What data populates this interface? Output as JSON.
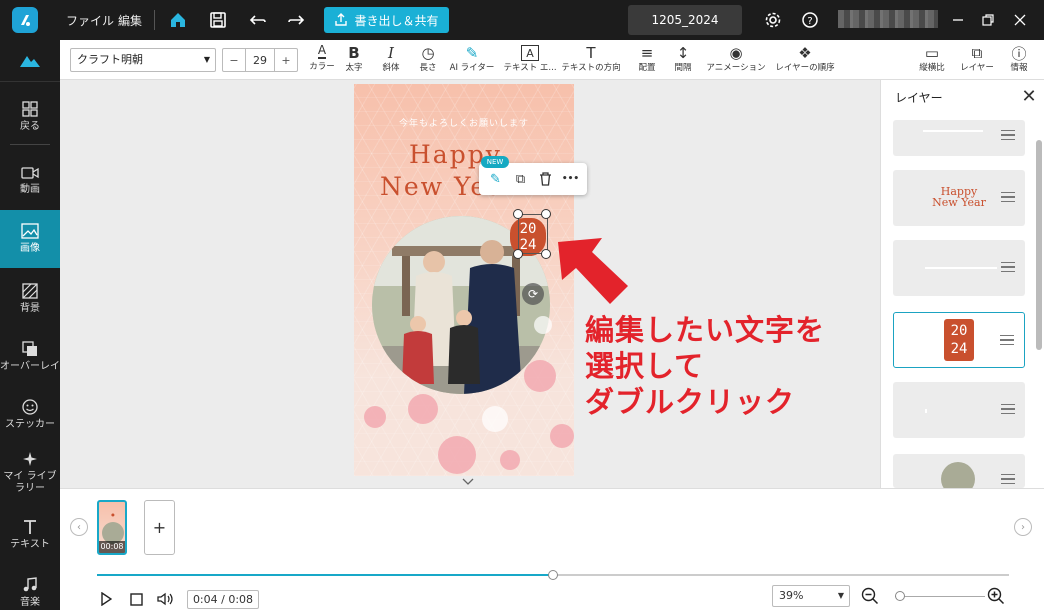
{
  "titlebar": {
    "menu_file": "ファイル",
    "menu_edit": "編集",
    "export_label": "書き出し＆共有",
    "project_name": "1205_2024"
  },
  "nav": {
    "items": [
      {
        "label": "戻る",
        "icon": "grid-icon"
      },
      {
        "label": "動画",
        "icon": "video-icon"
      },
      {
        "label": "画像",
        "icon": "image-icon",
        "active": true
      },
      {
        "label": "背景",
        "icon": "background-icon"
      },
      {
        "label": "オーバーレイ",
        "icon": "overlay-icon"
      },
      {
        "label": "ステッカー",
        "icon": "sticker-icon"
      },
      {
        "label": "マイ ライブラリー",
        "icon": "sparkle-icon"
      },
      {
        "label": "テキスト",
        "icon": "text-icon"
      },
      {
        "label": "音楽",
        "icon": "music-icon"
      }
    ]
  },
  "toolbar": {
    "font": "クラフト明朝",
    "font_size": "29",
    "minus": "−",
    "plus": "+",
    "tools": [
      {
        "label": "カラー",
        "glyph": "A"
      },
      {
        "label": "太字",
        "glyph": "B"
      },
      {
        "label": "斜体",
        "glyph": "I"
      },
      {
        "label": "長さ",
        "glyph": "◷"
      },
      {
        "label": "AI ライター",
        "glyph": "✎"
      },
      {
        "label": "テキスト エ...",
        "glyph": "A"
      },
      {
        "label": "テキストの方向",
        "glyph": "T"
      },
      {
        "label": "配置",
        "glyph": "≡"
      },
      {
        "label": "間隔",
        "glyph": "↕"
      },
      {
        "label": "アニメーション",
        "glyph": "◉"
      },
      {
        "label": "レイヤーの順序",
        "glyph": "❖"
      },
      {
        "label": "縦横比",
        "glyph": "▭"
      },
      {
        "label": "レイヤー",
        "glyph": "⧉"
      },
      {
        "label": "情報",
        "glyph": "ⓘ"
      }
    ]
  },
  "artboard": {
    "message": "今年もよろしくお願いします",
    "happy": "Happy",
    "new_year": "New Year",
    "year_top": "20",
    "year_bottom": "24"
  },
  "float_toolbar": {
    "badge": "NEW",
    "ai_glyph": "✎",
    "duplicate_glyph": "⧉",
    "delete_glyph": "🗑",
    "more_glyph": "•••"
  },
  "annotation": {
    "text": "編集したい文字を\n選択して\nダブルクリック",
    "color": "#e3232b"
  },
  "layers": {
    "title": "レイヤー",
    "close": "✕",
    "items": [
      {
        "type": "text-line"
      },
      {
        "type": "happy-new-year",
        "happy": "Happy",
        "new_year": "New Year"
      },
      {
        "type": "text-line"
      },
      {
        "type": "2024",
        "top": "20",
        "bottom": "24",
        "active": true
      },
      {
        "type": "blank"
      },
      {
        "type": "photo"
      }
    ]
  },
  "timeline": {
    "clip_time": "00:08",
    "add": "+",
    "prev": "‹",
    "next": "›",
    "progress_fraction": 0.5,
    "time_display": "0:04 / 0:08",
    "zoom": "39%",
    "zoom_fraction": 0.05
  },
  "colors": {
    "accent": "#18a8c8",
    "brand_red": "#c9502e"
  }
}
